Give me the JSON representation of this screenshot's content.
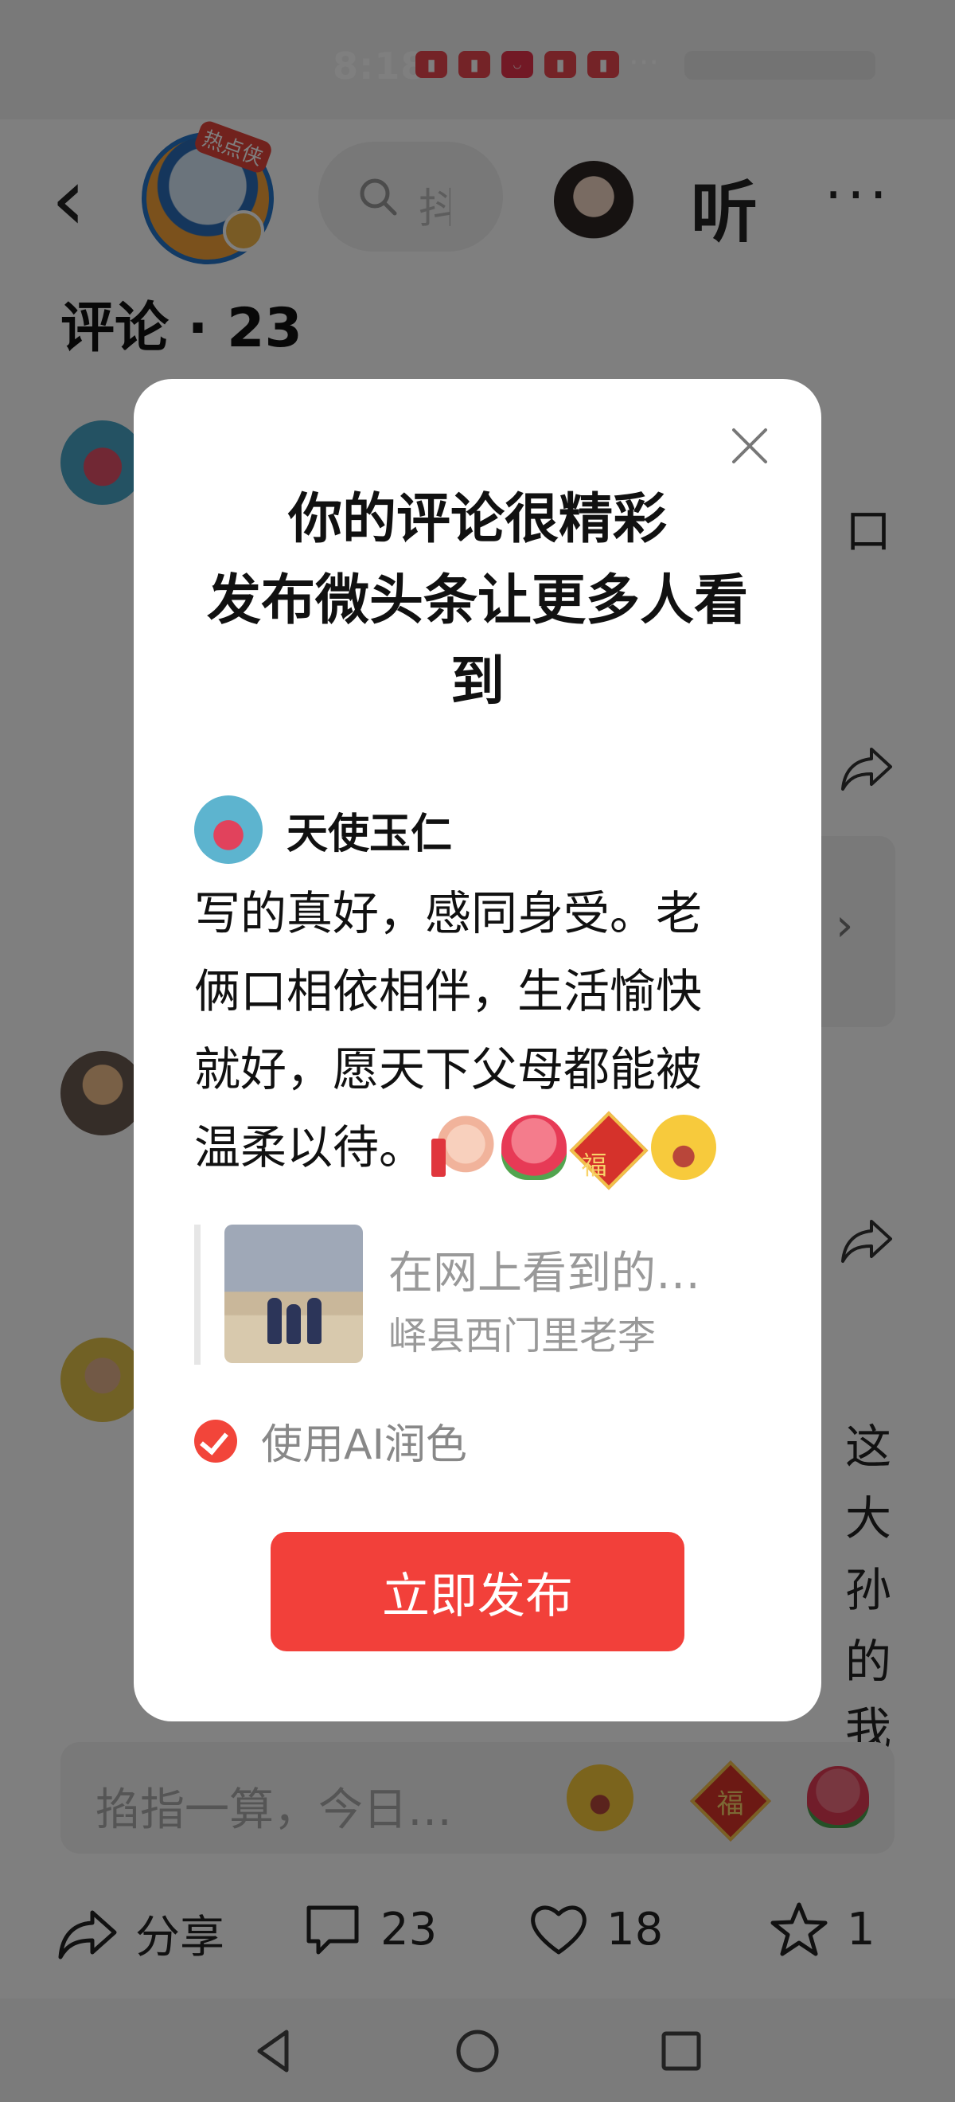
{
  "status_bar": {
    "time": "8:18",
    "dots": "···"
  },
  "header": {
    "author_badge": "热点侠",
    "search_hint": "抖",
    "listen_label": "听",
    "more_label": "···"
  },
  "comments": {
    "title": "评论 · 23",
    "bg_fragments": [
      "口",
      "这",
      "大",
      "孙",
      "的",
      "我"
    ]
  },
  "comment_bar": {
    "placeholder": "掐指一算，今日…",
    "fu_emoji": "福"
  },
  "actions": {
    "share_label": "分享",
    "comment_count": "23",
    "like_count": "18",
    "favorite_count": "1"
  },
  "modal": {
    "title_line1": "你的评论很精彩",
    "title_line2": "发布微头条让更多人看到",
    "user_name": "天使玉仁",
    "comment_text": "写的真好，感同身受。老俩口相依相伴，生活愉快就好，愿天下父母都能被温柔以待。",
    "fu_emoji": "福",
    "quote_title": "在网上看到的…",
    "quote_author": "峄县西门里老李",
    "ai_label": "使用AI润色",
    "ai_checked": true,
    "publish_label": "立即发布"
  },
  "colors": {
    "accent": "#f2403a",
    "overlay": "rgba(0,0,0,0.5)"
  },
  "icons": [
    "back-icon",
    "search-icon",
    "share-icon",
    "comment-icon",
    "heart-icon",
    "star-icon",
    "close-icon",
    "check-icon",
    "nav-back-icon",
    "nav-home-icon",
    "nav-recents-icon"
  ]
}
